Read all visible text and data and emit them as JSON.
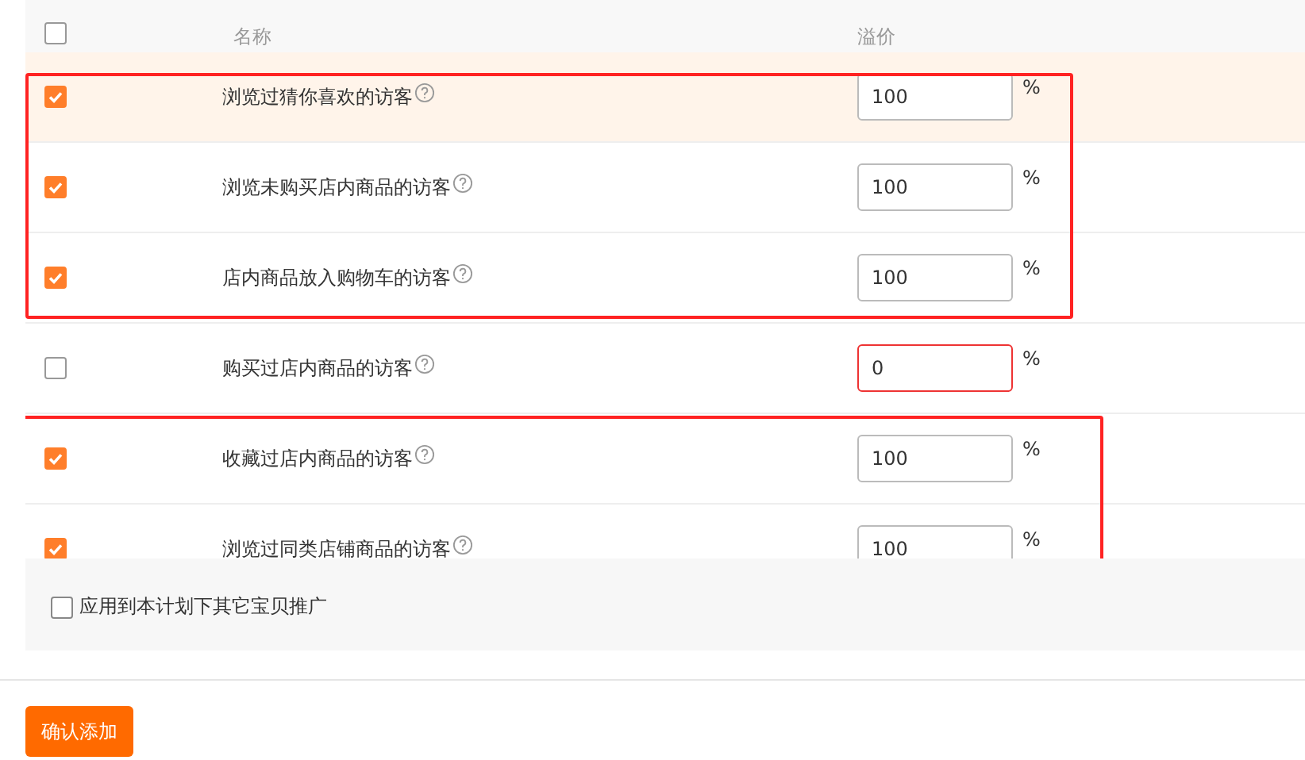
{
  "header": {
    "checked": false,
    "columns": [
      "名称",
      "溢价"
    ]
  },
  "row_groups": [
    {
      "highlighted": true,
      "rows": [
        {
          "checked": true,
          "hovered": true,
          "name": "浏览过猜你喜欢的访客",
          "value": "100",
          "error": false,
          "unit": "%"
        },
        {
          "checked": true,
          "hovered": false,
          "name": "浏览未购买店内商品的访客",
          "value": "100",
          "error": false,
          "unit": "%"
        },
        {
          "checked": true,
          "hovered": false,
          "name": "店内商品放入购物车的访客",
          "value": "100",
          "error": false,
          "unit": "%"
        }
      ]
    },
    {
      "highlighted": false,
      "rows": [
        {
          "checked": false,
          "hovered": false,
          "name": "购买过店内商品的访客",
          "value": "0",
          "error": true,
          "unit": "%"
        }
      ]
    },
    {
      "highlighted": true,
      "rows": [
        {
          "checked": true,
          "hovered": false,
          "name": "收藏过店内商品的访客",
          "value": "100",
          "error": false,
          "unit": "%"
        },
        {
          "checked": true,
          "hovered": false,
          "name": "浏览过同类店铺商品的访客",
          "value": "100",
          "error": false,
          "unit": "%"
        }
      ]
    }
  ],
  "apply_option": {
    "checked": false,
    "label": "应用到本计划下其它宝贝推广"
  },
  "confirm_button": "确认添加"
}
